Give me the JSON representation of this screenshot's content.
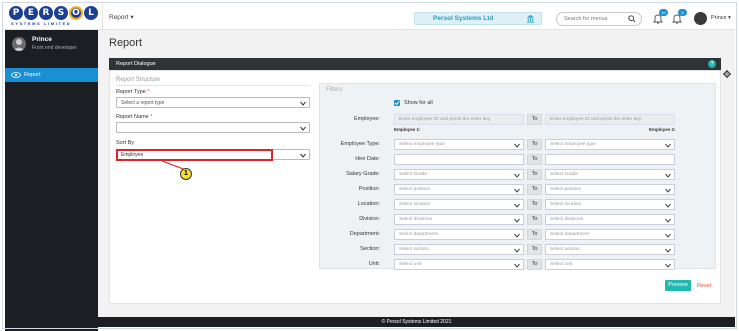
{
  "brand": {
    "letters": [
      "P",
      "E",
      "R",
      "S",
      "O",
      "L"
    ],
    "tagline": "SYSTEMS LIMITED",
    "colors": {
      "primary": "#1c3f94",
      "accent": "#f1b31c"
    }
  },
  "topbar": {
    "menu_label": "Report",
    "company": "Persol Systems Ltd",
    "search_placeholder": "Search for menus",
    "notif_badge_1": "10",
    "notif_badge_2": "3",
    "user": "Prince"
  },
  "sidebar": {
    "user_name": "Prince",
    "user_role": "Front end developer",
    "items": [
      {
        "label": "Report",
        "icon": "eye-icon",
        "active": true
      }
    ]
  },
  "page": {
    "title": "Report",
    "dialog_title": "Report Dialogue",
    "help_symbol": "?"
  },
  "report_structure": {
    "legend": "Report Structure",
    "report_type_label": "Report Type",
    "report_type_value": "Select a report type",
    "report_name_label": "Report Name",
    "report_name_value": "",
    "sort_by_label": "Sort By",
    "sort_by_value": "Employee",
    "required_mark": "*",
    "callout_number": "1"
  },
  "filters": {
    "legend": "Filters",
    "show_all_label": "Show for all",
    "show_all_checked": true,
    "to_label": "To",
    "employee_1_caption": "Employee 1:",
    "employee_2_caption": "Employee 2:",
    "rows": [
      {
        "label": "Employee:",
        "from": "Enter employee ID and press the enter key",
        "to": "Enter employee ID and press the enter key"
      },
      {
        "label": "Employee Type:",
        "from": "Select employee type",
        "to": "Select employee type"
      },
      {
        "label": "Hire Date:",
        "from": "",
        "to": ""
      },
      {
        "label": "Salary Grade:",
        "from": "Select Grade",
        "to": "Select Grade"
      },
      {
        "label": "Position:",
        "from": "Select position",
        "to": "Select position"
      },
      {
        "label": "Location:",
        "from": "Select location",
        "to": "Select location"
      },
      {
        "label": "Division:",
        "from": "Select divisions",
        "to": "Select divisions"
      },
      {
        "label": "Department:",
        "from": "Select department",
        "to": "Select department"
      },
      {
        "label": "Section:",
        "from": "Select section",
        "to": "Select section"
      },
      {
        "label": "Unit:",
        "from": "Select unit",
        "to": "Select unit"
      }
    ]
  },
  "actions": {
    "preview": "Preview",
    "reset": "Reset"
  },
  "footer": {
    "text": "© Persol Systems Limited 2021"
  }
}
